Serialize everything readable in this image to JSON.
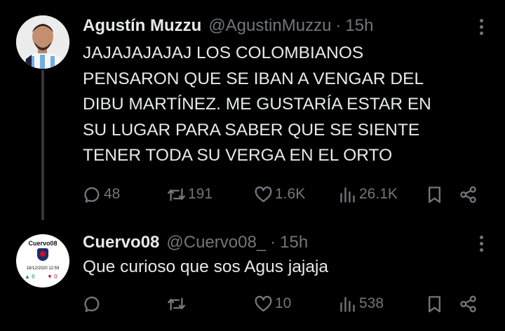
{
  "tweets": [
    {
      "name": "Agustín Muzzu",
      "handle": "@AgustinMuzzu",
      "separator": "·",
      "time": "15h",
      "text_lines": [
        "JAJAJAJAJAJ LOS COLOMBIANOS",
        "PENSARON QUE SE IBAN A VENGAR DEL",
        "DIBU MARTÍNEZ. ME GUSTARÍA ESTAR EN",
        "SU LUGAR PARA SABER QUE SE SIENTE",
        "TENER TODA SU VERGA EN EL ORTO"
      ],
      "replies": "48",
      "retweets": "191",
      "likes": "1.6K",
      "views": "26.1K"
    },
    {
      "name": "Cuervo08",
      "handle": "@Cuervo08_",
      "separator": "·",
      "time": "15h",
      "text_lines": [
        "Que curioso que sos Agus jajaja"
      ],
      "replies": "",
      "retweets": "",
      "likes": "10",
      "views": "538",
      "avatar": {
        "title": "Cuervo08",
        "date": "18/12/2020 12:59",
        "up": "6",
        "down": "0"
      }
    }
  ],
  "icons": {
    "reply": "reply-icon",
    "retweet": "retweet-icon",
    "like": "heart-icon",
    "views": "views-icon",
    "bookmark": "bookmark-icon",
    "share": "share-icon",
    "more": "more-icon"
  }
}
